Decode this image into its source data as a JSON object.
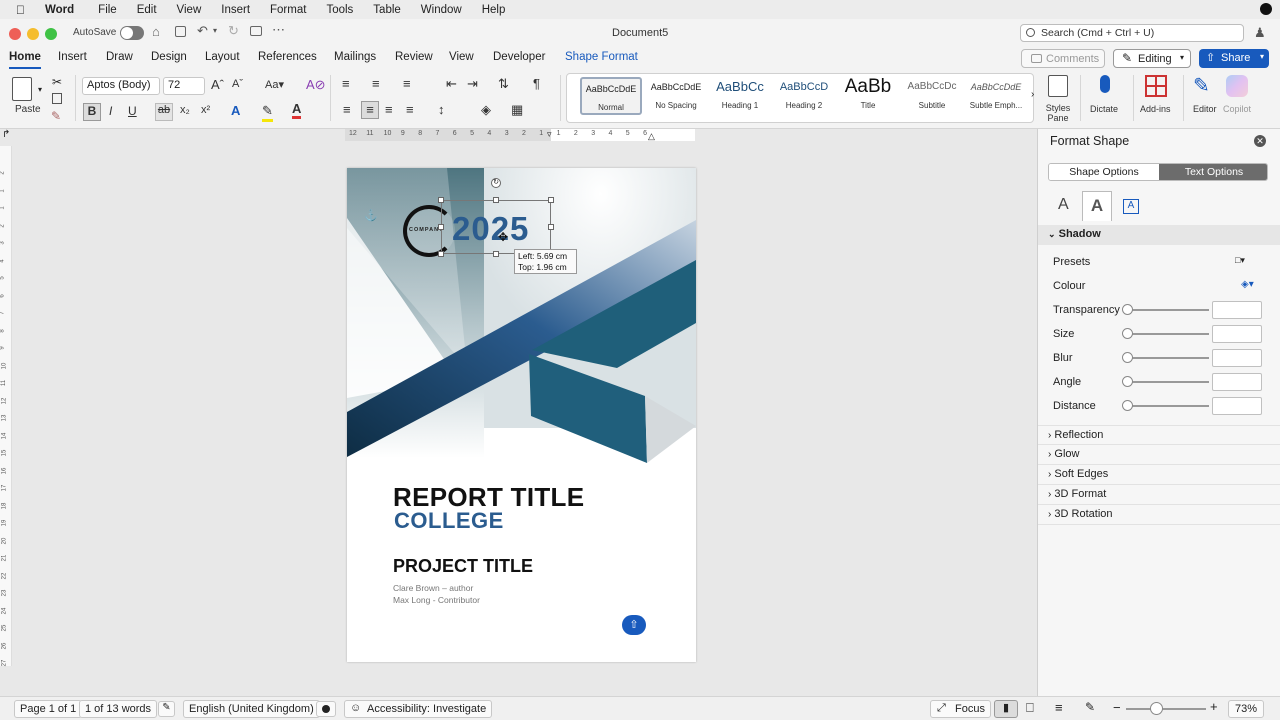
{
  "menubar": {
    "app": "Word",
    "items": [
      "File",
      "Edit",
      "View",
      "Insert",
      "Format",
      "Tools",
      "Table",
      "Window",
      "Help"
    ]
  },
  "titlebar": {
    "autosave": "AutoSave",
    "doc_title": "Document5",
    "search_placeholder": "Search (Cmd + Ctrl + U)"
  },
  "tabs": [
    "Home",
    "Insert",
    "Draw",
    "Design",
    "Layout",
    "References",
    "Mailings",
    "Review",
    "View",
    "Developer",
    "Shape Format"
  ],
  "ribbon_right": {
    "comments": "Comments",
    "editing": "Editing",
    "share": "Share"
  },
  "ribbon": {
    "paste": "Paste",
    "font_name": "Aptos (Body)",
    "font_size": "72",
    "styles": [
      {
        "preview": "AaBbCcDdE",
        "name": "Normal"
      },
      {
        "preview": "AaBbCcDdE",
        "name": "No Spacing"
      },
      {
        "preview": "AaBbCc",
        "name": "Heading 1"
      },
      {
        "preview": "AaBbCcD",
        "name": "Heading 2"
      },
      {
        "preview": "AaBb",
        "name": "Title"
      },
      {
        "preview": "AaBbCcDc",
        "name": "Subtitle"
      },
      {
        "preview": "AaBbCcDdE",
        "name": "Subtle Emph..."
      }
    ],
    "styles_pane": "Styles\nPane",
    "dictate": "Dictate",
    "addins": "Add-ins",
    "editor": "Editor",
    "copilot": "Copilot"
  },
  "ruler_labels": [
    "12",
    "11",
    "10",
    "9",
    "8",
    "7",
    "6",
    "5",
    "4",
    "3",
    "2",
    "1",
    "1",
    "2",
    "3",
    "4",
    "5",
    "6"
  ],
  "vruler_labels": [
    "2",
    "1",
    "1",
    "2",
    "3",
    "4",
    "5",
    "6",
    "7",
    "8",
    "9",
    "10",
    "11",
    "12",
    "13",
    "14",
    "15",
    "16",
    "17",
    "18",
    "19",
    "20",
    "21",
    "22",
    "23",
    "24",
    "25",
    "26",
    "27"
  ],
  "document": {
    "company": "COMPANY",
    "year": "2025",
    "tooltip_left": "Left: 5.69 cm",
    "tooltip_top": "Top: 1.96 cm",
    "report_title": "REPORT TITLE",
    "college": "COLLEGE",
    "project_title": "PROJECT TITLE",
    "author1": "Clare Brown – author",
    "author2": "Max Long - Contributor"
  },
  "panel": {
    "title": "Format Shape",
    "tab_shape": "Shape Options",
    "tab_text": "Text Options",
    "shadow": "Shadow",
    "presets": "Presets",
    "colour": "Colour",
    "rows": [
      "Transparency",
      "Size",
      "Blur",
      "Angle",
      "Distance"
    ],
    "sections": [
      "Reflection",
      "Glow",
      "Soft Edges",
      "3D Format",
      "3D Rotation"
    ]
  },
  "statusbar": {
    "page": "Page 1 of 1",
    "words": "1 of 13 words",
    "language": "English (United Kingdom)",
    "accessibility": "Accessibility: Investigate",
    "focus": "Focus",
    "zoom": "73%"
  },
  "colors": {
    "accent": "#185abd",
    "brand_blue": "#2b5c8f",
    "teal": "#1f5f7a",
    "dark_navy": "#0e2d44"
  }
}
